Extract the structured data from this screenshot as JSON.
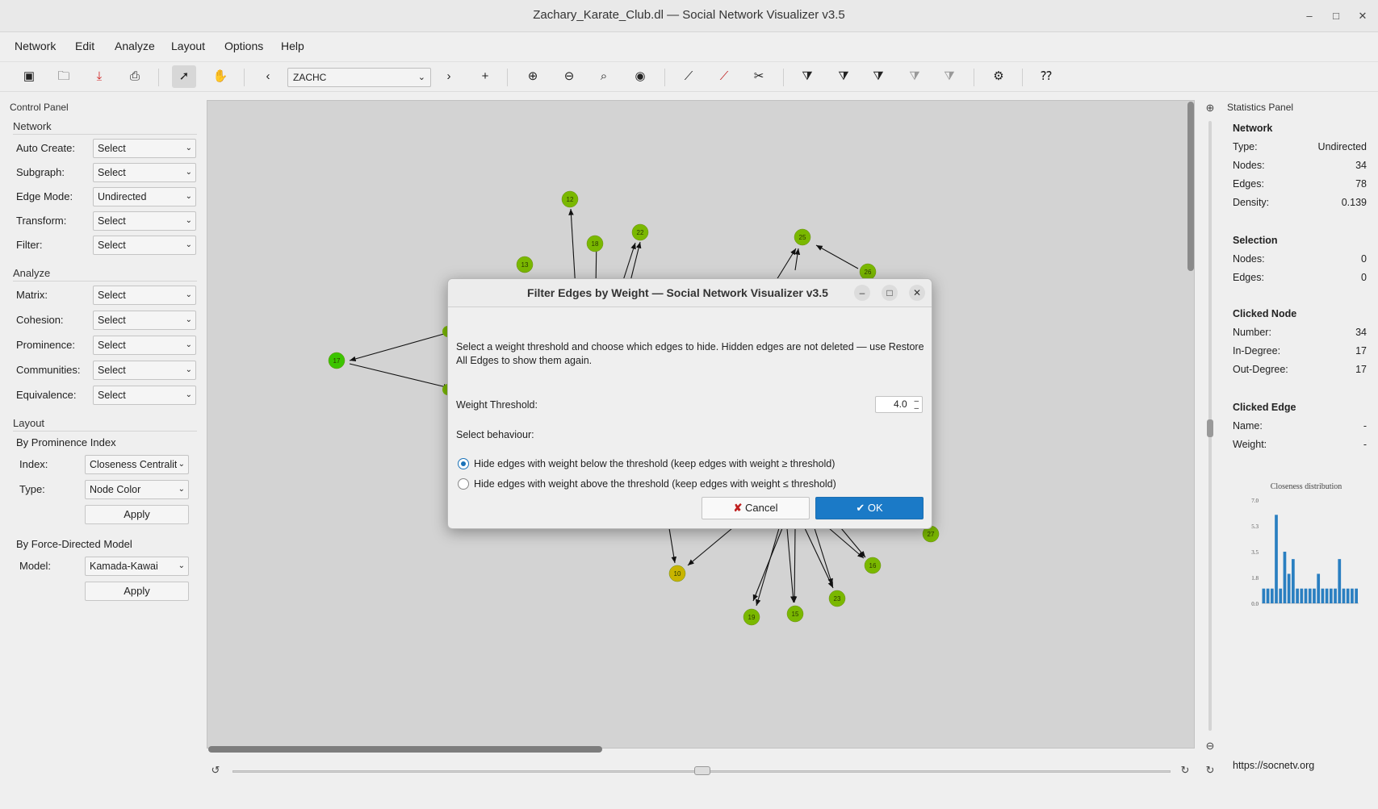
{
  "window": {
    "title": "Zachary_Karate_Club.dl — Social Network Visualizer v3.5"
  },
  "menu": [
    "Network",
    "Edit",
    "Analyze",
    "Layout",
    "Options",
    "Help"
  ],
  "toolbar": {
    "relation_combo": "ZACHC"
  },
  "control_panel": {
    "title": "Control Panel",
    "network_section": "Network",
    "network_rows": [
      {
        "label": "Auto Create:",
        "value": "Select"
      },
      {
        "label": "Subgraph:",
        "value": "Select"
      },
      {
        "label": "Edge Mode:",
        "value": "Undirected"
      },
      {
        "label": "Transform:",
        "value": "Select"
      },
      {
        "label": "Filter:",
        "value": "Select"
      }
    ],
    "analyze_section": "Analyze",
    "analyze_rows": [
      {
        "label": "Matrix:",
        "value": "Select"
      },
      {
        "label": "Cohesion:",
        "value": "Select"
      },
      {
        "label": "Prominence:",
        "value": "Select"
      },
      {
        "label": "Communities:",
        "value": "Select"
      },
      {
        "label": "Equivalence:",
        "value": "Select"
      }
    ],
    "layout_section": "Layout",
    "prominence_group": "By Prominence Index",
    "index_label": "Index:",
    "index_value": "Closeness Centrality",
    "type_label": "Type:",
    "type_value": "Node Color",
    "apply_label": "Apply",
    "force_group": "By Force-Directed Model",
    "model_label": "Model:",
    "model_value": "Kamada-Kawai",
    "apply2_label": "Apply"
  },
  "graph": {
    "nodes": [
      {
        "id": "12",
        "color": "#7ab800"
      },
      {
        "id": "18",
        "color": "#7ab800"
      },
      {
        "id": "22",
        "color": "#7ab800"
      },
      {
        "id": "13",
        "color": "#7ab800"
      },
      {
        "id": "25",
        "color": "#7ab800"
      },
      {
        "id": "26",
        "color": "#7ab800"
      },
      {
        "id": "17",
        "color": "#3cc400"
      },
      {
        "id": "27",
        "color": "#7ab800"
      },
      {
        "id": "16",
        "color": "#7ab800"
      },
      {
        "id": "10",
        "color": "#c8b400"
      },
      {
        "id": "23",
        "color": "#7ab800"
      },
      {
        "id": "19",
        "color": "#7ab800"
      },
      {
        "id": "15",
        "color": "#7ab800"
      }
    ]
  },
  "statistics": {
    "title": "Statistics Panel",
    "network_heading": "Network",
    "network": [
      {
        "label": "Type:",
        "value": "Undirected"
      },
      {
        "label": "Nodes:",
        "value": "34"
      },
      {
        "label": "Edges:",
        "value": "78"
      },
      {
        "label": "Density:",
        "value": "0.139"
      }
    ],
    "selection_heading": "Selection",
    "selection": [
      {
        "label": "Nodes:",
        "value": "0"
      },
      {
        "label": "Edges:",
        "value": "0"
      }
    ],
    "clicked_node_heading": "Clicked Node",
    "clicked_node": [
      {
        "label": "Number:",
        "value": "34"
      },
      {
        "label": "In-Degree:",
        "value": "17"
      },
      {
        "label": "Out-Degree:",
        "value": "17"
      }
    ],
    "clicked_edge_heading": "Clicked Edge",
    "clicked_edge": [
      {
        "label": "Name:",
        "value": "-"
      },
      {
        "label": "Weight:",
        "value": "-"
      }
    ],
    "url": "https://socnetv.org"
  },
  "chart_data": {
    "type": "bar",
    "title": "Closeness distribution",
    "yticks": [
      "7.0",
      "5.3",
      "3.5",
      "1.8",
      "0.0"
    ],
    "ylim": [
      0,
      7
    ],
    "values": [
      1,
      1,
      1,
      6,
      1,
      3.5,
      2,
      3,
      1,
      1,
      1,
      1,
      1,
      2,
      1,
      1,
      1,
      1,
      3,
      1,
      1,
      1,
      1
    ]
  },
  "dialog": {
    "title": "Filter Edges by Weight — Social Network Visualizer v3.5",
    "text": "Select a weight threshold and choose which edges to hide. Hidden edges are not deleted — use Restore All Edges to show them again.",
    "threshold_label": "Weight Threshold:",
    "threshold_value": "4.0",
    "behaviour_label": "Select behaviour:",
    "option1": "Hide edges with weight below the threshold  (keep edges with weight ≥ threshold)",
    "option2": "Hide edges with weight above the threshold  (keep edges with weight ≤ threshold)",
    "cancel": "Cancel",
    "ok": "OK"
  }
}
